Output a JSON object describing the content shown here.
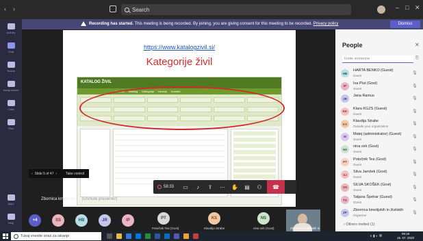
{
  "titlebar": {
    "search_placeholder": "Search",
    "back_glyph": "‹",
    "forward_glyph": "›",
    "user_initials": "KS",
    "minimize": "–",
    "maximize": "□",
    "close": "✕"
  },
  "rail": {
    "items": [
      {
        "label": "Activity",
        "icon": "bell-icon"
      },
      {
        "label": "Chat",
        "icon": "chat-icon"
      },
      {
        "label": "Teams",
        "icon": "teams-icon"
      },
      {
        "label": "Assignments",
        "icon": "assignments-icon"
      },
      {
        "label": "Calls",
        "icon": "phone-icon"
      },
      {
        "label": "Files",
        "icon": "files-icon"
      },
      {
        "label": "Apps",
        "icon": "apps-icon"
      },
      {
        "label": "Help",
        "icon": "help-icon"
      }
    ]
  },
  "banner": {
    "strong": "Recording has started.",
    "text": " This meeting is being recorded. By joining, you are giving consent for this meeting to be recorded.",
    "link": "Privacy policy",
    "dismiss": "Dismiss"
  },
  "slide": {
    "url": "https://www.katalogzivil.si/",
    "title": "Kategorije živil",
    "site_logo": "KATALOG ŽIVIL",
    "site_nav": [
      "Domov",
      "Katalog",
      "Kategorije",
      "Iskanje",
      "Kontakt"
    ]
  },
  "slide_nav": {
    "prev": "‹",
    "label": "Slide 5 of 47",
    "next": "›",
    "take_control": "Take control"
  },
  "presenter": {
    "name": "Zbornica kmetijskih in",
    "suffix": " (Unmute presenter)"
  },
  "controls": {
    "timer": "58:33",
    "icons": [
      "video-icon",
      "mic-icon",
      "share-icon",
      "more-icon",
      "raise-hand-icon",
      "chat-icon",
      "participants-icon"
    ],
    "hangup": "hangup-icon"
  },
  "strip": {
    "bubbles": [
      {
        "initials": "+4",
        "color": "#5b5fc7",
        "text": "#ffffff"
      },
      {
        "initials": "SS",
        "color": "#e7b7bb",
        "text": "#8a2b36"
      },
      {
        "initials": "HB",
        "color": "#b9dde3",
        "text": "#1d5a65"
      },
      {
        "initials": "JR",
        "color": "#c6c6ea",
        "text": "#39397a"
      },
      {
        "initials": "IP",
        "color": "#e8b5c8",
        "text": "#8a2250"
      }
    ],
    "tiles": [
      {
        "initials": "PT",
        "name": "Potočnik Tea (Gost)",
        "color": "#d8d8d8",
        "text": "#444444"
      },
      {
        "initials": "KS",
        "name": "Klavdija Strabe",
        "color": "#f3c9a5",
        "text": "#8a4b16"
      },
      {
        "initials": "NS",
        "name": "nina sirk (Gost)",
        "color": "#cfe4d0",
        "text": "#2b5a33"
      }
    ],
    "video_name": "Zbornica kmetijskih in"
  },
  "people": {
    "title": "People",
    "close": "✕",
    "invite_placeholder": "Invite someone",
    "list": [
      {
        "initials": "HB",
        "name": "HARTA BENKO (Guest)",
        "sub": "Guest",
        "color": "#b9dde3",
        "text": "#1d5a65"
      },
      {
        "initials": "IP",
        "name": "Iva Plut (Gost)",
        "sub": "Guest",
        "color": "#e8b5c8",
        "text": "#8a2250"
      },
      {
        "initials": "JR",
        "name": "Jana Ramus",
        "sub": "",
        "color": "#c6c6ea",
        "text": "#39397a"
      },
      {
        "initials": "KK",
        "name": "Klara KGZS (Guest)",
        "sub": "Guest",
        "color": "#f4c2c2",
        "text": "#8a2b2b"
      },
      {
        "initials": "KS",
        "name": "Klavdija Strabe",
        "sub": "Outside your organization",
        "color": "#f3c9a5",
        "text": "#8a4b16"
      },
      {
        "initials": "M",
        "name": "Matej (administrator) (Guest)",
        "sub": "Guest",
        "color": "#d9c7ec",
        "text": "#5b2f8a"
      },
      {
        "initials": "NS",
        "name": "nina sirk (Gost)",
        "sub": "Guest",
        "color": "#cfe4d0",
        "text": "#2b5a33"
      },
      {
        "initials": "PT",
        "name": "Potočnik Tea (Gost)",
        "sub": "Guest",
        "color": "#f2d0c4",
        "text": "#8a3b22"
      },
      {
        "initials": "SJ",
        "name": "Silva Jamšek (Gost)",
        "sub": "Guest",
        "color": "#f4c2c2",
        "text": "#8a2b2b"
      },
      {
        "initials": "SS",
        "name": "SILVA SKOŠEK (Gost)",
        "sub": "Guest",
        "color": "#e7b7bb",
        "text": "#8a2b36"
      },
      {
        "initials": "TS",
        "name": "Tatjana Špehar (Guest)",
        "sub": "Guest",
        "color": "#e8b5c8",
        "text": "#8a2250"
      },
      {
        "initials": "ZP",
        "name": "Zbornica kmetijskih in živilskih",
        "sub": "Organizer",
        "color": "#c6c6ea",
        "text": "#39397a"
      }
    ],
    "others": "› Others invited (1)"
  },
  "taskbar": {
    "search_placeholder": "Tukaj vnesite izraz za iskanje",
    "time": "09:18",
    "date": "15. 07. 2020",
    "tray": "∧ ▮ ◐ ⌘"
  }
}
